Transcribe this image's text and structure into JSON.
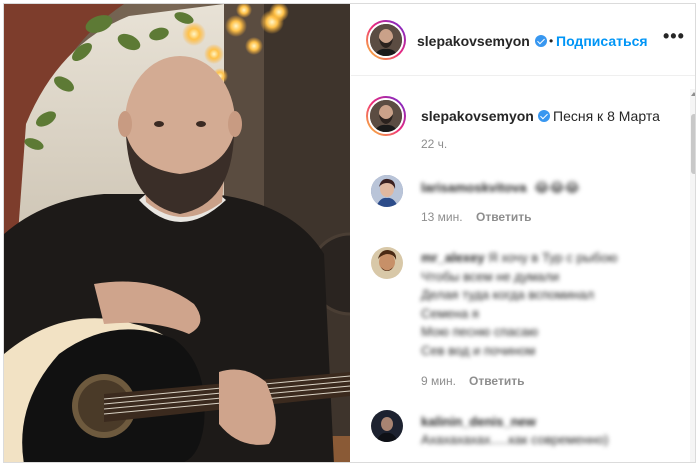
{
  "post": {
    "username": "slepakovsemyon",
    "verified": true,
    "follow_label": "Подписаться",
    "separator": "•",
    "more_icon": "more-horizontal-icon"
  },
  "caption": {
    "username": "slepakovsemyon",
    "text": "Песня к 8 Марта",
    "time": "22 ч."
  },
  "comments": [
    {
      "username": "larisamoskvitova",
      "text": "😂😂😂",
      "time": "13 мин.",
      "reply_label": "Ответить"
    },
    {
      "username": "mr_alexey",
      "lines": [
        "Я хочу в Тур с рыбою",
        "Чтобы всем не думали",
        "Делая туда когда вспоминал",
        "Семена я",
        "Мою песню спасаю",
        "Сев вод и почином"
      ],
      "time": "9 мин.",
      "reply_label": "Ответить"
    },
    {
      "username": "kalinin_denis_new",
      "text": "Ахахахахах.....как современно)"
    }
  ],
  "colors": {
    "accent": "#0095f6",
    "verified": "#3897f0",
    "muted": "#8e8e8e",
    "text": "#262626"
  }
}
